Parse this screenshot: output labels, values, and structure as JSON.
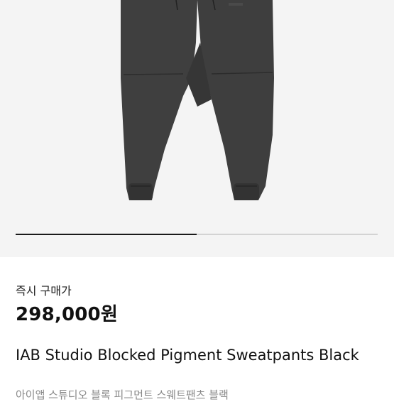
{
  "product": {
    "image_icon": "sweatpants-image",
    "carousel_progress": 0.5,
    "price_label": "즉시 구매가",
    "price": "298,000원",
    "title_en": "IAB Studio Blocked Pigment Sweatpants Black",
    "title_ko": "아이앱 스튜디오 블록 피그먼트 스웨트팬츠 블랙"
  },
  "colors": {
    "image_bg": "#f4f4f4",
    "pants": "#3f3f3f",
    "progress_active": "#1a1a1a",
    "progress_track": "#d3d3d3"
  }
}
